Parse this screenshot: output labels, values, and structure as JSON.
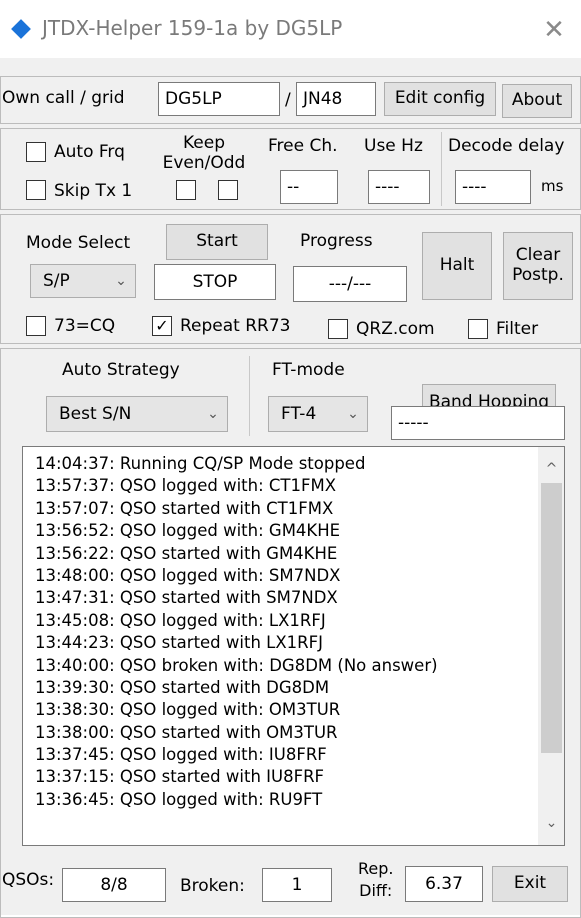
{
  "window": {
    "title": "JTDX-Helper 159-1a by DG5LP",
    "close_glyph": "✕"
  },
  "own": {
    "label": "Own call / grid",
    "call": "DG5LP",
    "separator": "/",
    "grid": "JN48",
    "edit_config_label": "Edit config",
    "about_label": "About"
  },
  "settings": {
    "auto_frq_label": "Auto Frq",
    "auto_frq_checked": false,
    "skip_tx1_label": "Skip Tx 1",
    "skip_tx1_checked": false,
    "keep_even_odd_label_1": "Keep",
    "keep_even_odd_label_2": "Even/Odd",
    "keep_even_checked": false,
    "keep_odd_checked": false,
    "free_ch_label": "Free Ch.",
    "free_ch_value": "--",
    "use_hz_label": "Use Hz",
    "use_hz_value": "----",
    "decode_delay_label": "Decode delay",
    "decode_delay_value": "----",
    "decode_delay_unit": "ms"
  },
  "mode": {
    "mode_select_label": "Mode Select",
    "mode_value": "S/P",
    "start_label": "Start",
    "status_value": "STOP",
    "progress_label": "Progress",
    "progress_value": "---/---",
    "halt_label": "Halt",
    "clear_label_1": "Clear",
    "clear_label_2": "Postp.",
    "opt_73cq_label": "73=CQ",
    "opt_73cq_checked": false,
    "opt_repeat_label": "Repeat RR73",
    "opt_repeat_checked": true,
    "opt_qrz_label": "QRZ.com",
    "opt_qrz_checked": false,
    "opt_filter_label": "Filter",
    "opt_filter_checked": false
  },
  "strategy": {
    "auto_strategy_label": "Auto Strategy",
    "auto_strategy_value": "Best S/N",
    "ft_mode_label": "FT-mode",
    "ft_mode_value": "FT-4",
    "band_hopping_label": "Band Hopping",
    "band_value": "-----"
  },
  "log": {
    "lines": [
      "14:04:37: Running CQ/SP Mode stopped",
      "13:57:37: QSO logged with: CT1FMX",
      "13:57:07: QSO started with CT1FMX",
      "13:56:52: QSO logged with: GM4KHE",
      "13:56:22: QSO started with GM4KHE",
      "13:48:00: QSO logged with: SM7NDX",
      "13:47:31: QSO started with SM7NDX",
      "13:45:08: QSO logged with: LX1RFJ",
      "13:44:23: QSO started with LX1RFJ",
      "13:40:00: QSO broken with: DG8DM (No answer)",
      "13:39:30: QSO started with DG8DM",
      "13:38:30: QSO logged with: OM3TUR",
      "13:38:00: QSO started with OM3TUR",
      "13:37:45: QSO logged with: IU8FRF",
      "13:37:15: QSO started with IU8FRF",
      "13:36:45: QSO logged with: RU9FT"
    ],
    "scroll_up_glyph": "^",
    "scroll_down_glyph": "⌄"
  },
  "footer": {
    "qsos_label": "QSOs:",
    "qsos_value": "8/8",
    "broken_label": "Broken:",
    "broken_value": "1",
    "rep_diff_label_1": "Rep.",
    "rep_diff_label_2": "Diff:",
    "rep_diff_value": "6.37",
    "exit_label": "Exit"
  },
  "colors": {
    "window_bg": "#f0f0f0",
    "title_icon": "#1a73d9",
    "title_text": "#7a7a7a"
  }
}
